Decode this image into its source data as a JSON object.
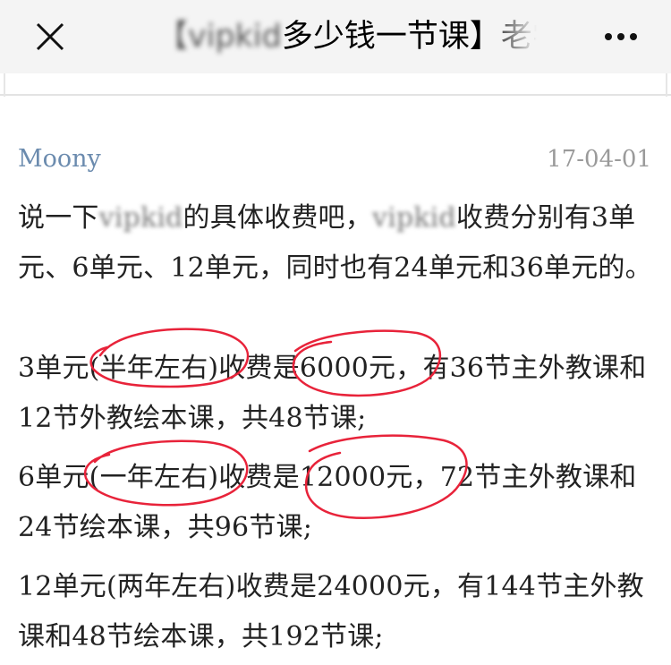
{
  "navbar": {
    "close_icon": "close-icon",
    "title_blurred_part": "【vipkid",
    "title_text": "多少钱一节课】老学",
    "more_icon": "more-dots-icon"
  },
  "comment": {
    "author": "Moony",
    "date": "17-04-01",
    "p1": {
      "a": "说一下",
      "b": "vipkid",
      "c": "的具体收费吧，",
      "d": "vipkid",
      "e": "收费分别有3单元、6单元、12单元，同时也有24单元和36单元的。"
    },
    "p2": "3单元(半年左右)收费是6000元，有36节主外教课和12节外教绘本课，共48节课;",
    "p3": "6单元(一年左右)收费是12000元，72节主外教课和24节绘本课，共96节课;",
    "p4": "12单元(两年左右)收费是24000元，有144节主外教课和48节绘本课，共192节课;"
  },
  "colors": {
    "navbar_bg": "#f4f4f4",
    "author": "#6b8bae",
    "date": "#9a9a9a",
    "body_text": "#222222",
    "annotation": "#e8233a"
  }
}
